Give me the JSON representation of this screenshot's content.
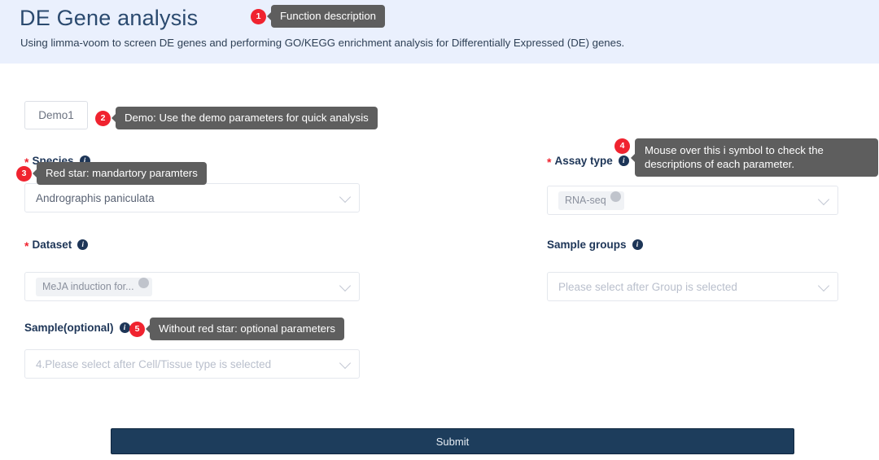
{
  "header": {
    "title": "DE Gene analysis",
    "subtitle": "Using limma-voom to screen DE genes and performing GO/KEGG enrichment analysis for Differentially Expressed (DE) genes."
  },
  "callouts": {
    "one": {
      "number": "1",
      "text": "Function description"
    },
    "two": {
      "number": "2",
      "text": "Demo: Use the demo parameters for quick analysis"
    },
    "three": {
      "number": "3",
      "text": "Red star: mandartory paramters"
    },
    "four": {
      "number": "4",
      "text": "Mouse over this i symbol to check the descriptions of each parameter."
    },
    "five": {
      "number": "5",
      "text": "Without red star: optional parameters"
    }
  },
  "demo": {
    "label": "Demo1"
  },
  "fields": {
    "species": {
      "label": "Species",
      "required_star": "*",
      "info": "i",
      "value": "Andrographis paniculata"
    },
    "assay_type": {
      "label": "Assay type",
      "required_star": "*",
      "info": "i",
      "chip": "RNA-seq",
      "chip_close": "✕"
    },
    "dataset": {
      "label": "Dataset",
      "required_star": "*",
      "info": "i",
      "chip": "MeJA induction for...",
      "chip_close": "✕"
    },
    "sample_groups": {
      "label": "Sample groups",
      "info": "i",
      "placeholder": "Please select after Group is selected"
    },
    "sample_optional": {
      "label": "Sample(optional)",
      "info": "i",
      "placeholder": "4.Please select after Cell/Tissue type is selected"
    }
  },
  "submit": {
    "label": "Submit"
  },
  "colors": {
    "header_bg": "#eaf0fd",
    "title": "#2b4a6f",
    "badge_red": "#f0232f",
    "tooltip_bg": "#5e5e5e",
    "submit_bg": "#1d3d5c",
    "info_icon": "#1d3557"
  }
}
